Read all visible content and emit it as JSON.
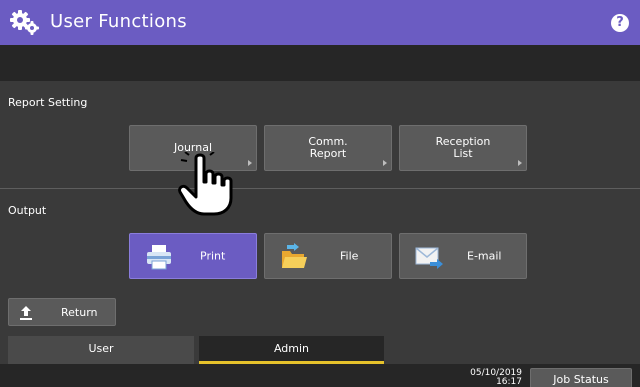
{
  "header": {
    "title": "User Functions",
    "help_icon": "?"
  },
  "report_setting": {
    "label": "Report Setting",
    "buttons": [
      {
        "label": "Journal"
      },
      {
        "label": "Comm.\nReport"
      },
      {
        "label": "Reception\nList"
      }
    ]
  },
  "output": {
    "label": "Output",
    "buttons": [
      {
        "label": "Print",
        "icon": "printer-icon",
        "selected": true
      },
      {
        "label": "File",
        "icon": "folder-icon",
        "selected": false
      },
      {
        "label": "E-mail",
        "icon": "email-icon",
        "selected": false
      }
    ]
  },
  "return_label": "Return",
  "tabs": [
    {
      "label": "User",
      "active": false
    },
    {
      "label": "Admin",
      "active": true
    }
  ],
  "status": {
    "date": "05/10/2019",
    "time": "16:17",
    "job_status_label": "Job Status"
  },
  "colors": {
    "accent": "#6b5cc2",
    "tab_indicator": "#e6c22b",
    "background": "#3a3a3a"
  }
}
